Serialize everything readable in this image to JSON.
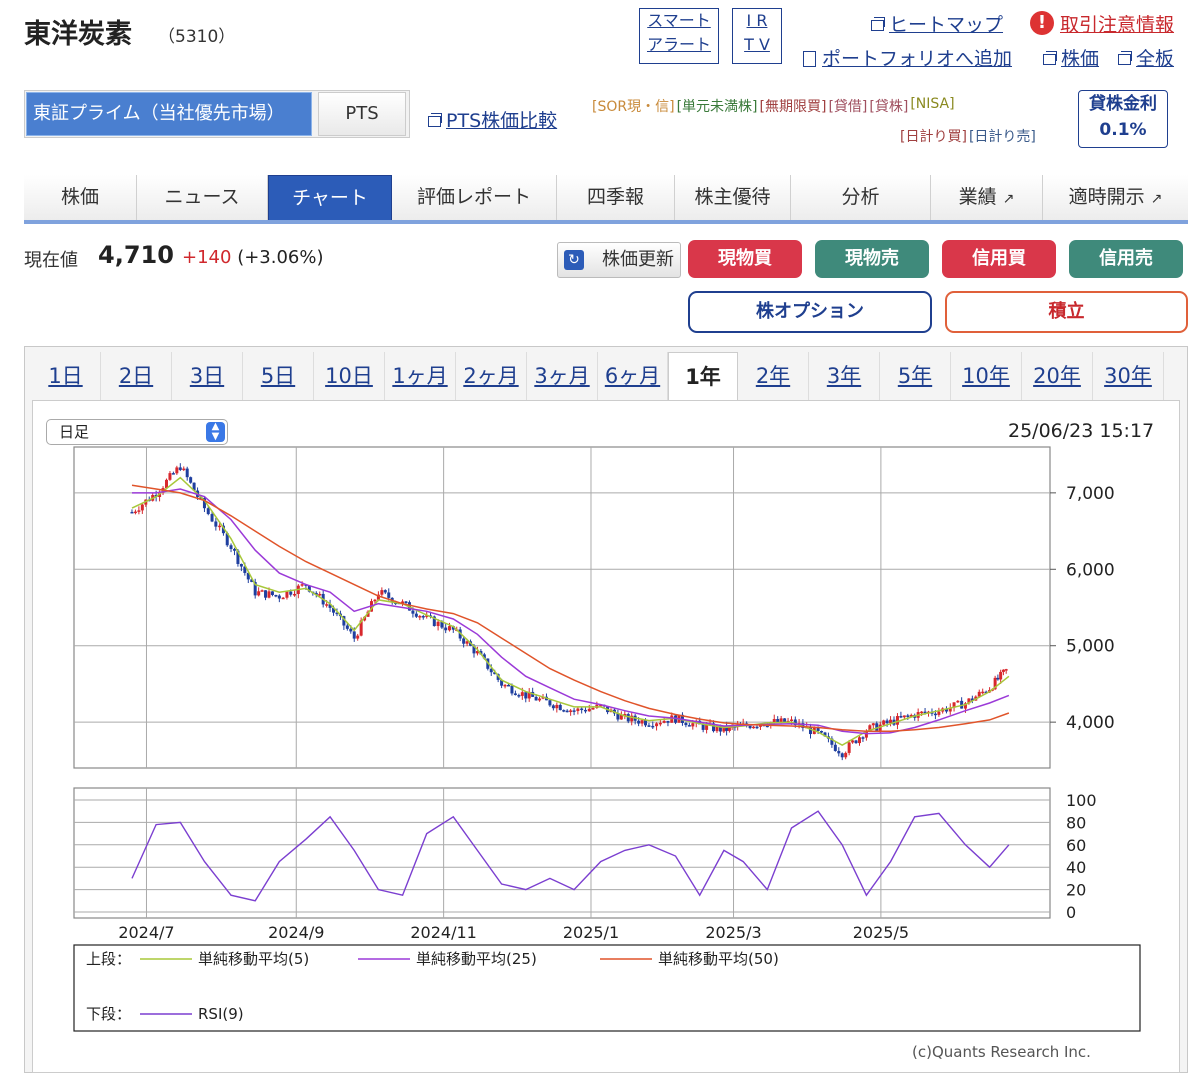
{
  "header": {
    "company": "東洋炭素",
    "code": "（5310）",
    "smart_alert": [
      "スマート",
      "アラート"
    ],
    "irtv": [
      "I R",
      "T V"
    ],
    "heatmap": "ヒートマップ",
    "warning": "取引注意情報",
    "portfolio": "ポートフォリオへ追加",
    "stock_price": "株価",
    "full_board": "全板"
  },
  "market": {
    "primary": "東証プライム（当社優先市場）",
    "pts": "PTS",
    "pts_compare": "PTS株価比較",
    "tags_row1": [
      "[SOR現・信]",
      "[単元未満株]",
      "[無期限買]",
      "[貸借]",
      "[貸株]",
      "[NISA]"
    ],
    "tags_row2": [
      "[日計り買]",
      "[日計り売]"
    ],
    "lending_label": "貸株金利",
    "lending_rate": "0.1%"
  },
  "nav": [
    "株価",
    "ニュース",
    "チャート",
    "評価レポート",
    "四季報",
    "株主優待",
    "分析",
    "業績",
    "適時開示"
  ],
  "nav_active": 2,
  "price": {
    "label": "現在値",
    "value": "4,710",
    "change": "+140",
    "change_pct": "(+3.06%)",
    "refresh": "株価更新"
  },
  "trade": {
    "cash_buy": "現物買",
    "cash_sell": "現物売",
    "margin_buy": "信用買",
    "margin_sell": "信用売",
    "option": "株オプション",
    "accumulate": "積立"
  },
  "periods": [
    "1日",
    "2日",
    "3日",
    "5日",
    "10日",
    "1ヶ月",
    "2ヶ月",
    "3ヶ月",
    "6ヶ月",
    "1年",
    "2年",
    "3年",
    "5年",
    "10年",
    "20年",
    "30年"
  ],
  "period_active": 9,
  "chart_controls": {
    "interval": "日足",
    "timestamp": "25/06/23 15:17",
    "copyright": "(c)Quants Research Inc."
  },
  "colors": {
    "accent": "#2c5cb8",
    "sma5": "#a8c83a",
    "sma25": "#9b3ad8",
    "sma50": "#e0542a",
    "rsi": "#7b3fd0",
    "up": "#d8282d",
    "down": "#1f3f9f"
  },
  "chart_data": [
    {
      "type": "line",
      "x_ticks": [
        "2024/7",
        "2024/9",
        "2024/11",
        "2025/1",
        "2025/3",
        "2025/5"
      ],
      "y_ticks": [
        4000,
        5000,
        6000,
        7000
      ],
      "y_tick_labels": [
        "4,000",
        "5,000",
        "6,000",
        "7,000"
      ],
      "ylim": [
        3400,
        7600
      ],
      "x": [
        "2024-06-25",
        "2024-07-05",
        "2024-07-15",
        "2024-07-25",
        "2024-08-05",
        "2024-08-15",
        "2024-08-25",
        "2024-09-05",
        "2024-09-15",
        "2024-09-25",
        "2024-10-05",
        "2024-10-15",
        "2024-10-25",
        "2024-11-05",
        "2024-11-15",
        "2024-11-25",
        "2024-12-05",
        "2024-12-15",
        "2024-12-25",
        "2025-01-05",
        "2025-01-15",
        "2025-01-25",
        "2025-02-05",
        "2025-02-15",
        "2025-02-25",
        "2025-03-05",
        "2025-03-15",
        "2025-03-25",
        "2025-04-05",
        "2025-04-15",
        "2025-04-25",
        "2025-05-05",
        "2025-05-15",
        "2025-05-25",
        "2025-06-05",
        "2025-06-15",
        "2025-06-23"
      ],
      "series": [
        {
          "name": "価格",
          "values": [
            6750,
            7000,
            7350,
            6800,
            6300,
            5700,
            5650,
            5800,
            5500,
            5100,
            5700,
            5550,
            5350,
            5200,
            4900,
            4500,
            4350,
            4250,
            4150,
            4200,
            4050,
            4000,
            4050,
            3950,
            3900,
            3950,
            4000,
            4000,
            3850,
            3600,
            3900,
            4000,
            4100,
            4150,
            4250,
            4450,
            4710
          ]
        },
        {
          "name": "単純移動平均(5)",
          "values": [
            6800,
            6950,
            7200,
            6900,
            6400,
            5800,
            5700,
            5750,
            5550,
            5200,
            5600,
            5550,
            5400,
            5250,
            4950,
            4550,
            4400,
            4300,
            4200,
            4200,
            4080,
            4020,
            4050,
            3980,
            3930,
            3950,
            3990,
            4000,
            3870,
            3700,
            3880,
            3980,
            4080,
            4150,
            4230,
            4400,
            4600
          ]
        },
        {
          "name": "単純移動平均(25)",
          "values": [
            7000,
            7000,
            7050,
            6950,
            6650,
            6250,
            5950,
            5800,
            5700,
            5450,
            5550,
            5500,
            5450,
            5350,
            5150,
            4850,
            4600,
            4450,
            4300,
            4230,
            4150,
            4080,
            4050,
            4000,
            3950,
            3960,
            3970,
            3980,
            3960,
            3880,
            3850,
            3860,
            3930,
            4030,
            4150,
            4250,
            4350
          ]
        },
        {
          "name": "単純移動平均(50)",
          "values": [
            7100,
            7050,
            7000,
            6900,
            6700,
            6500,
            6300,
            6100,
            5950,
            5800,
            5650,
            5550,
            5480,
            5420,
            5300,
            5100,
            4900,
            4700,
            4550,
            4400,
            4280,
            4180,
            4100,
            4040,
            3990,
            3970,
            3960,
            3950,
            3930,
            3900,
            3880,
            3880,
            3900,
            3930,
            3980,
            4030,
            4120
          ]
        }
      ]
    },
    {
      "type": "line",
      "y_ticks": [
        0,
        20,
        40,
        60,
        80,
        100
      ],
      "ylim": [
        0,
        100
      ],
      "series": [
        {
          "name": "RSI(9)",
          "values": [
            30,
            78,
            80,
            45,
            15,
            10,
            45,
            65,
            85,
            55,
            20,
            15,
            70,
            85,
            55,
            25,
            20,
            30,
            20,
            45,
            55,
            60,
            50,
            15,
            55,
            45,
            20,
            75,
            90,
            60,
            15,
            45,
            85,
            88,
            60,
            40,
            60
          ]
        }
      ]
    }
  ],
  "legend": {
    "upper": "上段：",
    "lower": "下段：",
    "sma5": "単純移動平均(5)",
    "sma25": "単純移動平均(25)",
    "sma50": "単純移動平均(50)",
    "rsi": "RSI(9)"
  }
}
